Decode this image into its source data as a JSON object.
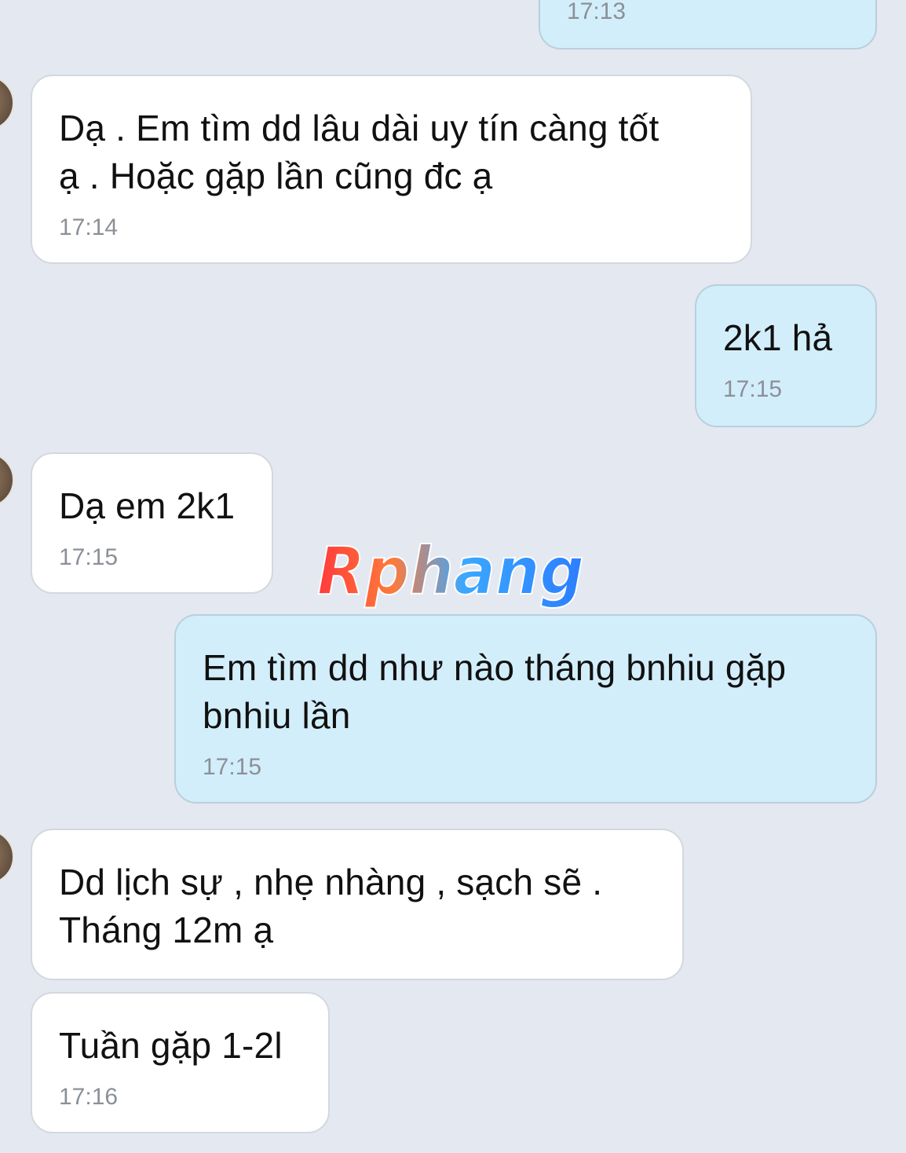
{
  "conversation": {
    "messages": [
      {
        "direction": "out",
        "text": "",
        "time": "17:13"
      },
      {
        "direction": "in",
        "text": "Dạ . Em tìm dd lâu dài uy tín càng tốt\nạ . Hoặc gặp lần cũng đc ạ",
        "time": "17:14"
      },
      {
        "direction": "out",
        "text": "2k1 hả",
        "time": "17:15"
      },
      {
        "direction": "in",
        "text": "Dạ em 2k1",
        "time": "17:15"
      },
      {
        "direction": "out",
        "text": "Em tìm dd như nào tháng bnhiu gặp\nbnhiu lần",
        "time": "17:15"
      },
      {
        "direction": "in",
        "text": "Dd lịch sự , nhẹ nhàng , sạch sẽ .\nTháng 12m ạ",
        "time": ""
      },
      {
        "direction": "in",
        "text": "Tuần gặp 1-2l",
        "time": "17:16"
      }
    ]
  },
  "watermark": {
    "text": "Rphang",
    "colors": [
      "#ff3b3b",
      "#ff7a3a",
      "#3aa8ff",
      "#2d7dff"
    ]
  },
  "theme": {
    "background": "#e3e8f1",
    "incoming_bubble": "#ffffff",
    "outgoing_bubble": "#d3eefb",
    "timestamp_color": "#8b9097"
  }
}
